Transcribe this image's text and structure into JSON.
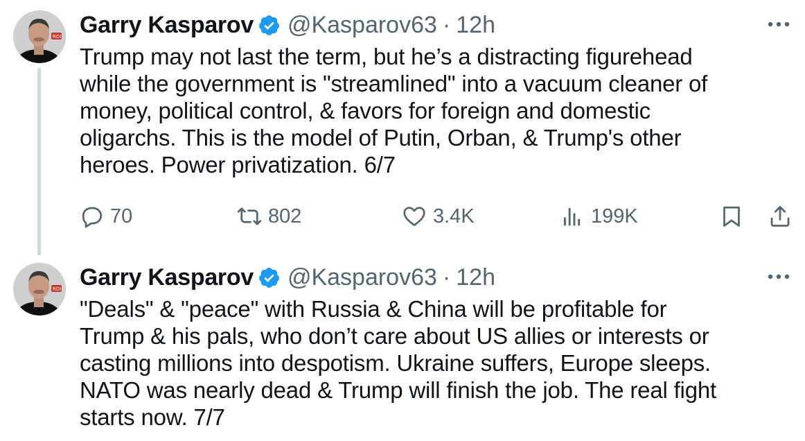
{
  "tweets": [
    {
      "author": {
        "name": "Garry Kasparov",
        "handle": "@Kasparov63"
      },
      "separator": "·",
      "time": "12h",
      "text": "Trump may not last the term, but he’s a distracting figurehead\nwhile the government is \"streamlined\" into a vacuum cleaner of\nmoney, political control, & favors for foreign and domestic\noligarchs. This is the model of Putin, Orban, & Trump's other\nheroes. Power privatization. 6/7",
      "stats": {
        "replies": "70",
        "retweets": "802",
        "likes": "3.4K",
        "views": "199K"
      }
    },
    {
      "author": {
        "name": "Garry Kasparov",
        "handle": "@Kasparov63"
      },
      "separator": "·",
      "time": "12h",
      "text": "\"Deals\" & \"peace\" with Russia & China will be profitable for\nTrump & his pals, who don’t care about US allies or interests or\ncasting millions into despotism. Ukraine suffers, Europe sleeps.\nNATO was nearly dead & Trump will finish the job. The real fight\nstarts now. 7/7"
    }
  ],
  "icons": {
    "verified": "verified-badge-icon",
    "more": "more-dots-icon",
    "reply": "reply-icon",
    "retweet": "retweet-icon",
    "like": "heart-icon",
    "views": "views-icon",
    "bookmark": "bookmark-icon",
    "share": "share-icon"
  },
  "colors": {
    "verified": "#1d9bf0",
    "text": "#0f1419",
    "muted": "#536471",
    "thread_line": "#cfd9de"
  }
}
